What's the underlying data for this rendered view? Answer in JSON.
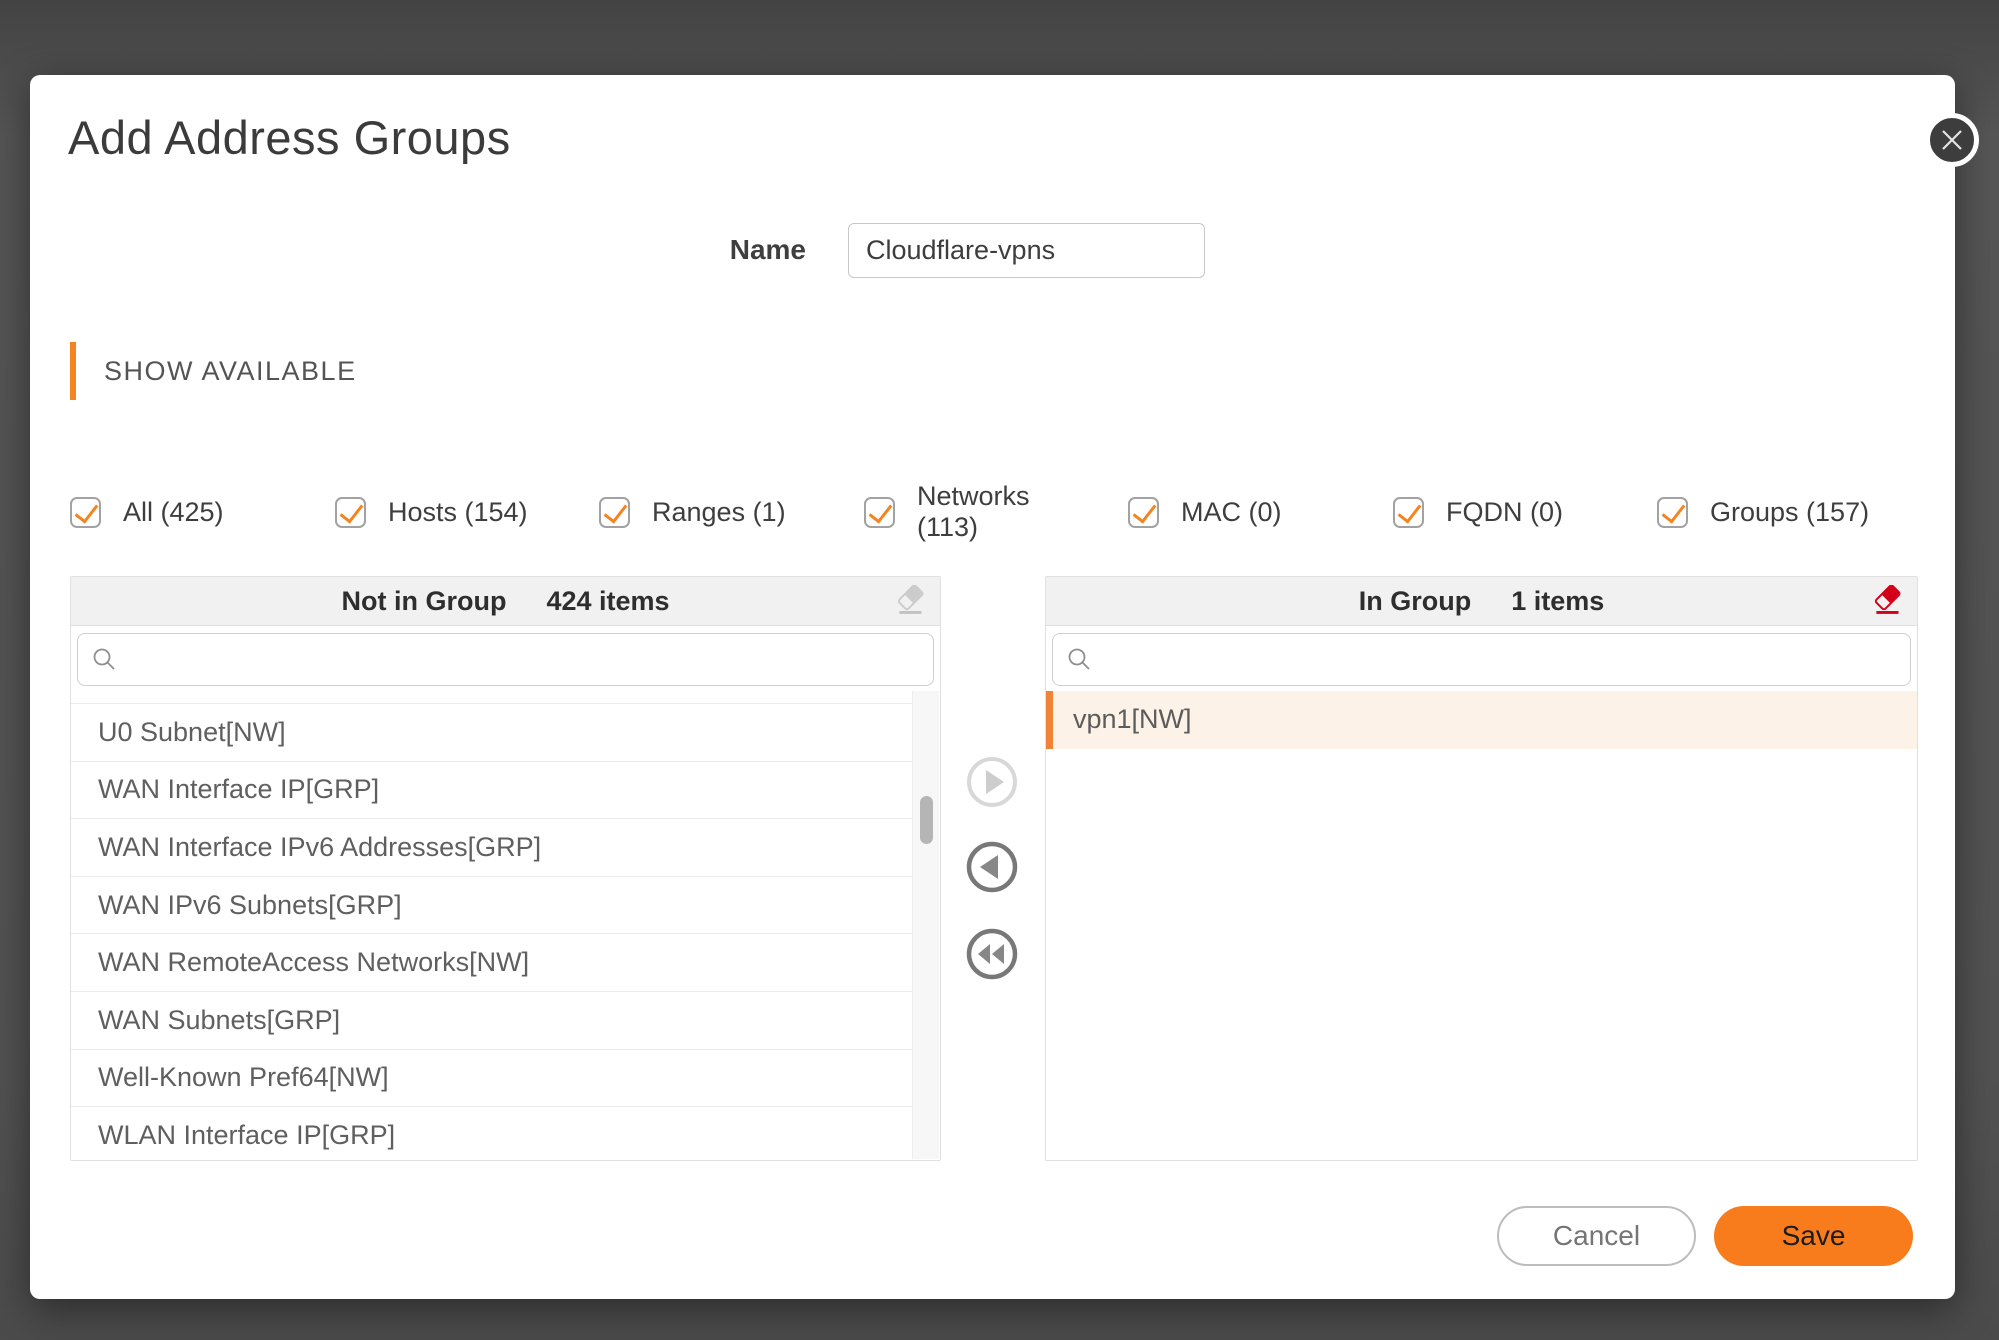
{
  "dialog": {
    "title": "Add Address Groups"
  },
  "name_field": {
    "label": "Name",
    "value": "Cloudflare-vpns"
  },
  "section": {
    "heading": "SHOW AVAILABLE"
  },
  "filters": [
    {
      "label": "All (425)",
      "checked": true
    },
    {
      "label": "Hosts (154)",
      "checked": true
    },
    {
      "label": "Ranges (1)",
      "checked": true
    },
    {
      "label": "Networks (113)",
      "checked": true
    },
    {
      "label": "MAC (0)",
      "checked": true
    },
    {
      "label": "FQDN (0)",
      "checked": true
    },
    {
      "label": "Groups (157)",
      "checked": true
    }
  ],
  "not_in_group": {
    "title": "Not in Group",
    "count_label": "424 items",
    "search_value": "",
    "items": [
      "U0 Subnet[NW]",
      "WAN Interface IP[GRP]",
      "WAN Interface IPv6 Addresses[GRP]",
      "WAN IPv6 Subnets[GRP]",
      "WAN RemoteAccess Networks[NW]",
      "WAN Subnets[GRP]",
      "Well-Known Pref64[NW]",
      "WLAN Interface IP[GRP]"
    ]
  },
  "in_group": {
    "title": "In Group",
    "count_label": "1 items",
    "search_value": "",
    "items": [
      {
        "label": "vpn1[NW]",
        "selected": true
      }
    ]
  },
  "footer": {
    "cancel_label": "Cancel",
    "save_label": "Save"
  },
  "colors": {
    "accent": "#f5831f",
    "save": "#f87c1c",
    "danger": "#d40019",
    "selected_bg": "#fdf2e7"
  }
}
